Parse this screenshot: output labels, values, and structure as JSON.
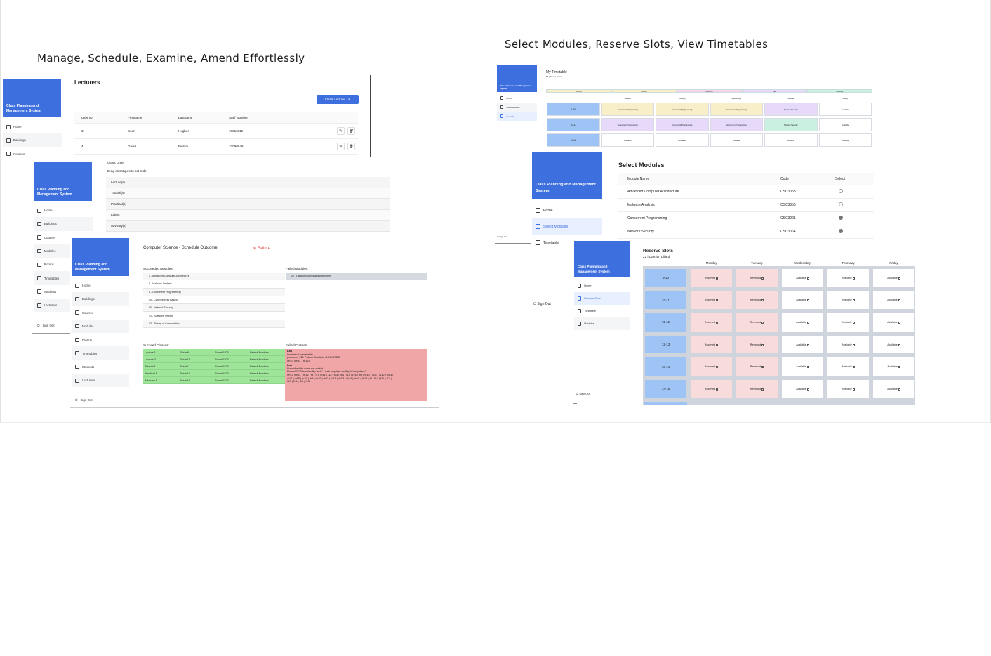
{
  "headings": {
    "left": "Manage, Schedule, Examine, Amend Effortlessly",
    "right": "Select Modules, Reserve Slots, View Timetables"
  },
  "app_name": "Class Planning and Management System",
  "admin_nav": [
    "Home",
    "Buildings",
    "Courses",
    "Modules",
    "Rooms",
    "Timetables",
    "Students",
    "Lecturers"
  ],
  "sign_out": "Sign Out",
  "lecturers": {
    "title": "Lecturers",
    "create_button": "Create Lecturer",
    "columns": [
      "User ID",
      "Firstname",
      "Lastname",
      "Staff Number"
    ],
    "rows": [
      [
        "3",
        "Sean",
        "Hughes",
        "10011515"
      ],
      [
        "4",
        "David",
        "Pietala",
        "10090049"
      ]
    ]
  },
  "class_order": {
    "title": "Class Order",
    "subtitle": "Drag classtypes to set order",
    "items": [
      "Lecture(s)",
      "Tutorial(s)",
      "Practical(s)",
      "Lab(s)",
      "Advisory(s)"
    ]
  },
  "schedule": {
    "title": "Computer Science - Schedule Outcome",
    "status": "Failure",
    "status_color": "#d9534f",
    "succeeded_modules_label": "Succeeded Modules:",
    "succeeded_modules": [
      "1 - Advanced Computer Architecture",
      "2 - Malware Analysis",
      "5 - Concurrent Programming",
      "10 - Cybersecurity Basics",
      "20 - Network Security",
      "21 - Software Testing",
      "23 - Theory of Computation"
    ],
    "failed_modules_label": "Failed Modules:",
    "failed_modules": [
      "22 - Data Structures and Algorithms"
    ],
    "succeed_classes_label": "Succeed Classes:",
    "succeed_classes": [
      [
        "Lecture 1",
        "Slot m9",
        "Room 0203",
        "Patrick Broderic"
      ],
      [
        "Lecture 2",
        "Slot m13",
        "Room 0203",
        "Patrick Broderic"
      ],
      [
        "Tutorial 1",
        "Slot m11",
        "Room 0203",
        "Patrick Broderic"
      ],
      [
        "Practical 1",
        "Slot m12",
        "Room 0203",
        "Patrick Broderic"
      ],
      [
        "Advisory 1",
        "Slot m13",
        "Room 0203",
        "Patrick Broderic"
      ]
    ],
    "failed_classes_label": "Failed Classes:",
    "failed_classes": [
      {
        "title": "Lab",
        "lines": [
          "Lecturer Unavailable",
          "(Lecturer 121 Patrick Broderic OCCUPIED",
          "[m10 | m11 | m12]"
        ]
      },
      {
        "title": "Lab",
        "lines": [
          "Room facility does not match",
          "Room 0203 has facility \"null\" - Lab requires facility \"Computers\"",
          "[m10 | m11 | m12 | f9 | f10 | f11 | f12 | f13 | f14 | f15 | f16 | w9 | w10 | w11 | w12 | w13 |",
          "w14 | w15 | w16 | th9 | th10 | th11 | th12 | th13 | th14 | th15 | th16 | f9 | f10 | f11 | f12 |",
          "f13 | f14 | f15 | f16]"
        ]
      }
    ],
    "colors": {
      "success": "#9ee59a",
      "failure": "#f0a6a6",
      "failed_module": "#d5d9e0"
    }
  },
  "timetable": {
    "title": "My Timetable",
    "subtitle": "16 | Greg Lennon",
    "legend": [
      {
        "label": "Lecture",
        "color": "#f8efc8"
      },
      {
        "label": "Tutorial",
        "color": "#f8efc8"
      },
      {
        "label": "Practical",
        "color": "#f6d4ea"
      },
      {
        "label": "Lab",
        "color": "#e6d9fa"
      },
      {
        "label": "Advisory",
        "color": "#c9f0e0"
      }
    ],
    "days": [
      "Monday",
      "Tuesday",
      "Wednesday",
      "Thursday",
      "Friday"
    ],
    "rows": [
      {
        "time": "9-10",
        "cells": [
          "Concurrent Programming",
          "Concurrent Programming",
          "Concurrent Programming",
          "Network Security",
          "Available"
        ],
        "kinds": [
          "lec",
          "lec",
          "lec",
          "lab",
          "av"
        ]
      },
      {
        "time": "10-11",
        "cells": [
          "Concurrent Programming",
          "Concurrent Programming",
          "Concurrent Programming",
          "Network Security",
          "Available"
        ],
        "kinds": [
          "lab",
          "lab",
          "lab",
          "adv",
          "av"
        ]
      },
      {
        "time": "11-12",
        "cells": [
          "Available",
          "Available",
          "Available",
          "Available",
          "Available"
        ],
        "kinds": [
          "av",
          "av",
          "av",
          "av",
          "av"
        ]
      }
    ],
    "nav": [
      "Home",
      "Select Modules",
      "Timetable"
    ],
    "time_color": "#9ec3f5"
  },
  "select_modules": {
    "title": "Select Modules",
    "columns": [
      "Module Name",
      "Code",
      "Select"
    ],
    "rows": [
      {
        "name": "Advanced Computer Architecture",
        "code": "CSC3058",
        "selected": false
      },
      {
        "name": "Malware Analysis",
        "code": "CSC3056",
        "selected": false
      },
      {
        "name": "Concurrent Programming",
        "code": "CSC3021",
        "selected": true
      },
      {
        "name": "Network Security",
        "code": "CSC3064",
        "selected": true
      }
    ],
    "nav": [
      "Home",
      "Select Modules",
      "Timetable"
    ]
  },
  "reserve": {
    "title": "Reserve Slots",
    "subtitle": "22 | Damian Lillard",
    "days": [
      "Monday",
      "Tuesday",
      "Wednesday",
      "Thursday",
      "Friday"
    ],
    "times": [
      "9-10",
      "10-11",
      "11-12",
      "12-13",
      "13-14",
      "14-15"
    ],
    "reserved_label": "Reserved",
    "available_label": "Available",
    "nav": [
      "Home",
      "Reserve Slots",
      "Timetable",
      "Modules"
    ],
    "reserved_color": "#f8dcdc",
    "time_color": "#9ec3f5"
  }
}
